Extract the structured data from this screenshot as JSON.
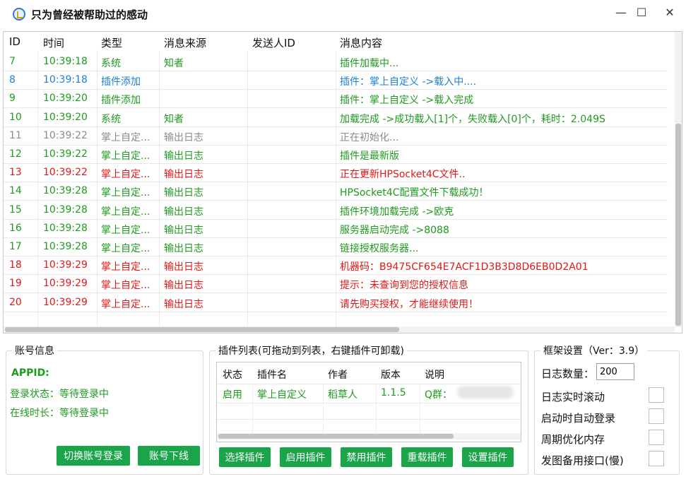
{
  "window": {
    "title": "只为曾经被帮助过的感动",
    "min_symbol": "—",
    "max_symbol": "☐",
    "close_symbol": "✕"
  },
  "log": {
    "columns": [
      "ID",
      "时间",
      "类型",
      "消息来源",
      "发送人ID",
      "消息内容"
    ],
    "rows": [
      {
        "id": "7",
        "time": "10:39:18",
        "type": "系统",
        "source": "知者",
        "sender": "",
        "msg": "插件加载中...",
        "color": "green"
      },
      {
        "id": "8",
        "time": "10:39:18",
        "type": "插件添加",
        "source": "",
        "sender": "",
        "msg": "插件：掌上自定义 ->载入中....",
        "color": "blue"
      },
      {
        "id": "9",
        "time": "10:39:20",
        "type": "插件添加",
        "source": "",
        "sender": "",
        "msg": "插件：掌上自定义 ->载入完成",
        "color": "green"
      },
      {
        "id": "10",
        "time": "10:39:20",
        "type": "系统",
        "source": "知者",
        "sender": "",
        "msg": "加载完成 ->成功载入[1]个，失败载入[0]个，耗时：2.049S",
        "color": "green"
      },
      {
        "id": "11",
        "time": "10:39:22",
        "type": "掌上自定...",
        "source": "输出日志",
        "sender": "",
        "msg": "正在初始化...",
        "color": "gray"
      },
      {
        "id": "12",
        "time": "10:39:22",
        "type": "掌上自定...",
        "source": "输出日志",
        "sender": "",
        "msg": "插件是最新版",
        "color": "green"
      },
      {
        "id": "13",
        "time": "10:39:22",
        "type": "掌上自定...",
        "source": "输出日志",
        "sender": "",
        "msg": "正在更新HPSocket4C文件..",
        "color": "red"
      },
      {
        "id": "14",
        "time": "10:39:28",
        "type": "掌上自定...",
        "source": "输出日志",
        "sender": "",
        "msg": "HPSocket4C配置文件下载成功！",
        "color": "green"
      },
      {
        "id": "15",
        "time": "10:39:28",
        "type": "掌上自定...",
        "source": "输出日志",
        "sender": "",
        "msg": "插件环境加载完成 ->欧克",
        "color": "green"
      },
      {
        "id": "16",
        "time": "10:39:28",
        "type": "掌上自定...",
        "source": "输出日志",
        "sender": "",
        "msg": "服务器启动完成 ->8088",
        "color": "green"
      },
      {
        "id": "17",
        "time": "10:39:28",
        "type": "掌上自定...",
        "source": "输出日志",
        "sender": "",
        "msg": "链接授权服务器...",
        "color": "green"
      },
      {
        "id": "18",
        "time": "10:39:29",
        "type": "掌上自定...",
        "source": "输出日志",
        "sender": "",
        "msg": "机器码：B9475CF654E7ACF1D3B3D8D6EB0D2A01",
        "color": "red"
      },
      {
        "id": "19",
        "time": "10:39:29",
        "type": "掌上自定...",
        "source": "输出日志",
        "sender": "",
        "msg": "提示：未查询到您的授权信息",
        "color": "red"
      },
      {
        "id": "20",
        "time": "10:39:29",
        "type": "掌上自定...",
        "source": "输出日志",
        "sender": "",
        "msg": "请先购买授权，才能继续使用！",
        "color": "red"
      }
    ]
  },
  "account": {
    "legend": "账号信息",
    "appid_label": "APPID:",
    "login_status": "登录状态：等待登录中",
    "online_time": "在线时长：等待登录中",
    "switch_button": "切换账号登录",
    "logout_button": "账号下线"
  },
  "plugins": {
    "legend": "插件列表(可拖动到列表，右键插件可卸载)",
    "columns": [
      "状态",
      "插件名",
      "作者",
      "版本",
      "说明"
    ],
    "rows": [
      {
        "status": "启用",
        "name": "掌上自定义",
        "author": "稻草人",
        "version": "1.1.5",
        "desc": "Q群："
      }
    ],
    "buttons": [
      "选择插件",
      "启用插件",
      "禁用插件",
      "重载插件",
      "设置插件"
    ]
  },
  "settings": {
    "legend": "框架设置（Ver：3.9）",
    "log_count_label": "日志数量：",
    "log_count_value": "200",
    "options": [
      "日志实时滚动",
      "启动时自动登录",
      "周期优化内存",
      "发图备用接口(慢)"
    ]
  },
  "colors": {
    "green": "#1f9a1f",
    "blue": "#1e7fd6",
    "gray": "#8a8a8a",
    "red": "#e21818",
    "button": "#1aa54a"
  }
}
